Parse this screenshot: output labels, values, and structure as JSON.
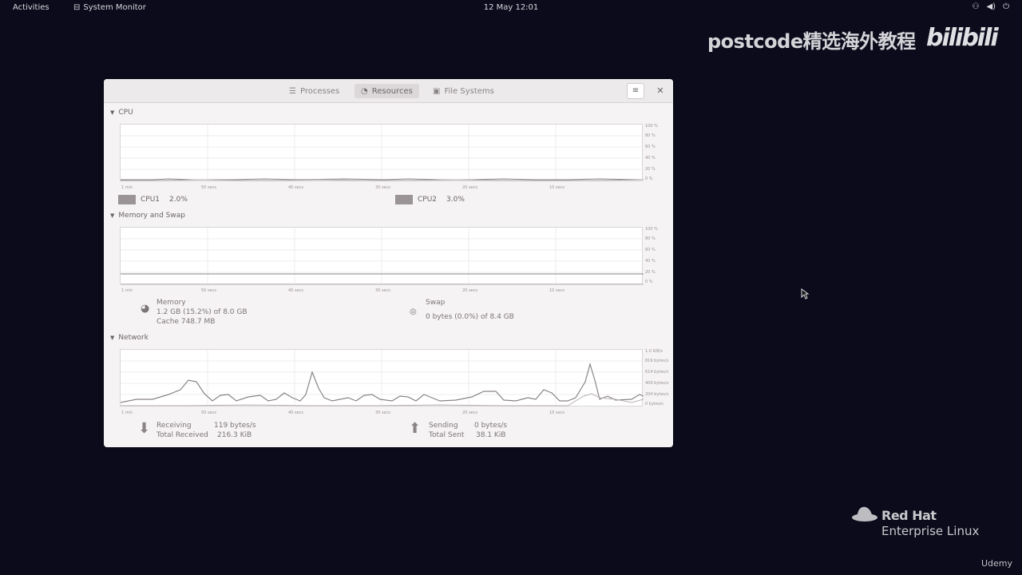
{
  "topbar": {
    "activities": "Activities",
    "app_name": "System Monitor",
    "clock": "12 May  12:01"
  },
  "watermark": {
    "text": "postcode精选海外教程",
    "brand": "bilibili"
  },
  "window": {
    "tabs": [
      {
        "label": "Processes",
        "icon": "list-icon"
      },
      {
        "label": "Resources",
        "icon": "gauge-icon"
      },
      {
        "label": "File Systems",
        "icon": "disk-icon"
      }
    ],
    "active_tab": 1
  },
  "cpu": {
    "title": "CPU",
    "x_labels": [
      "1 min",
      "50 secs",
      "40 secs",
      "30 secs",
      "20 secs",
      "10 secs"
    ],
    "y_labels": [
      "100 %",
      "80 %",
      "60 %",
      "40 %",
      "20 %",
      "0 %"
    ],
    "cores": [
      {
        "label": "CPU1",
        "value": "2.0%"
      },
      {
        "label": "CPU2",
        "value": "3.0%"
      }
    ]
  },
  "memory": {
    "title": "Memory and Swap",
    "x_labels": [
      "1 min",
      "50 secs",
      "40 secs",
      "30 secs",
      "20 secs",
      "10 secs"
    ],
    "y_labels": [
      "100 %",
      "80 %",
      "60 %",
      "40 %",
      "20 %",
      "0 %"
    ],
    "memory_label": "Memory",
    "memory_usage": "1.2 GB (15.2%) of 8.0 GB",
    "memory_cache": "Cache 748.7 MB",
    "swap_label": "Swap",
    "swap_usage": "0 bytes (0.0%) of 8.4 GB"
  },
  "network": {
    "title": "Network",
    "x_labels": [
      "1 min",
      "50 secs",
      "40 secs",
      "30 secs",
      "20 secs",
      "10 secs"
    ],
    "y_labels": [
      "1.0 KiB/s",
      "819 bytes/s",
      "614 bytes/s",
      "409 bytes/s",
      "204 bytes/s",
      "0 bytes/s"
    ],
    "receiving_label": "Receiving",
    "receiving_value": "119 bytes/s",
    "total_received_label": "Total Received",
    "total_received_value": "216.3 KiB",
    "sending_label": "Sending",
    "sending_value": "0 bytes/s",
    "total_sent_label": "Total Sent",
    "total_sent_value": "38.1 KiB"
  },
  "branding": {
    "redhat_line1": "Red Hat",
    "redhat_line2": "Enterprise Linux",
    "udemy": "Udemy"
  }
}
